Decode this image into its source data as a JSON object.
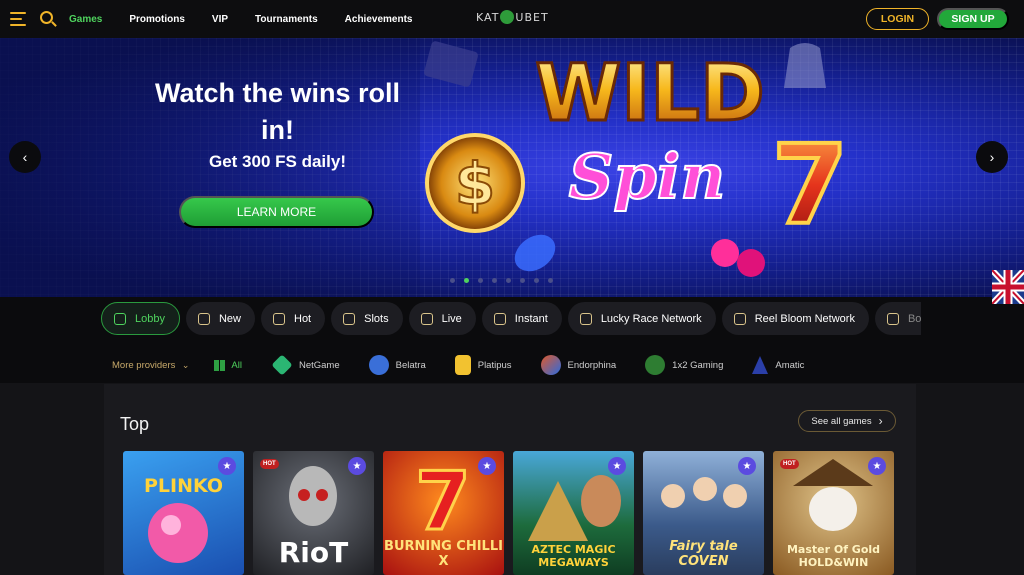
{
  "nav": {
    "items": [
      {
        "label": "Games",
        "active": true
      },
      {
        "label": "Promotions"
      },
      {
        "label": "VIP"
      },
      {
        "label": "Tournaments"
      },
      {
        "label": "Achievements"
      }
    ],
    "logo_left": "KAT",
    "logo_right": "UBET",
    "login_label": "LOGIN",
    "signup_label": "SIGN UP"
  },
  "banner": {
    "headline": "Watch the wins roll in!",
    "sub": "Get 300 FS daily!",
    "cta": "LEARN MORE",
    "art_title_1": "WILD",
    "art_title_2": "Spin",
    "art_seven": "7",
    "art_dollar": "$",
    "slides_total": 8,
    "slide_active": 2,
    "prev_icon": "chevron-left-icon",
    "next_icon": "chevron-right-icon",
    "language_icon": "uk-flag-icon"
  },
  "categories": [
    {
      "label": "Lobby",
      "active": true
    },
    {
      "label": "New"
    },
    {
      "label": "Hot"
    },
    {
      "label": "Slots"
    },
    {
      "label": "Live"
    },
    {
      "label": "Instant"
    },
    {
      "label": "Lucky Race Network"
    },
    {
      "label": "Reel Bloom Network"
    },
    {
      "label": "Bonus W"
    }
  ],
  "providers": {
    "more_label": "More providers",
    "all_label": "All",
    "items": [
      {
        "label": "NetGame",
        "color": "#2bb673"
      },
      {
        "label": "Belatra",
        "color": "#3a6fd8"
      },
      {
        "label": "Platipus",
        "color": "#f2c230"
      },
      {
        "label": "Endorphina",
        "color": "#e0592a"
      },
      {
        "label": "1x2 Gaming",
        "color": "#2e7d32"
      },
      {
        "label": "Amatic",
        "color": "#2b3fa8"
      }
    ]
  },
  "top": {
    "title": "Top",
    "see_all": "See all games",
    "hot_label": "HOT",
    "games": [
      {
        "title": "PLINKO",
        "bg": "#2a7fd6",
        "hot": false
      },
      {
        "title": "RioT",
        "bg": "#3a3d44",
        "hot": true
      },
      {
        "title": "BURNING CHILLI X",
        "bg": "#b01818",
        "hot": false
      },
      {
        "title": "AZTEC MAGIC MEGAWAYS",
        "bg": "#1d6b3c",
        "hot": false
      },
      {
        "title": "Fairy tale COVEN",
        "bg": "#3b5a8a",
        "hot": false
      },
      {
        "title": "Master Of Gold HOLD&WIN",
        "bg": "#8a5a22",
        "hot": true
      }
    ]
  }
}
